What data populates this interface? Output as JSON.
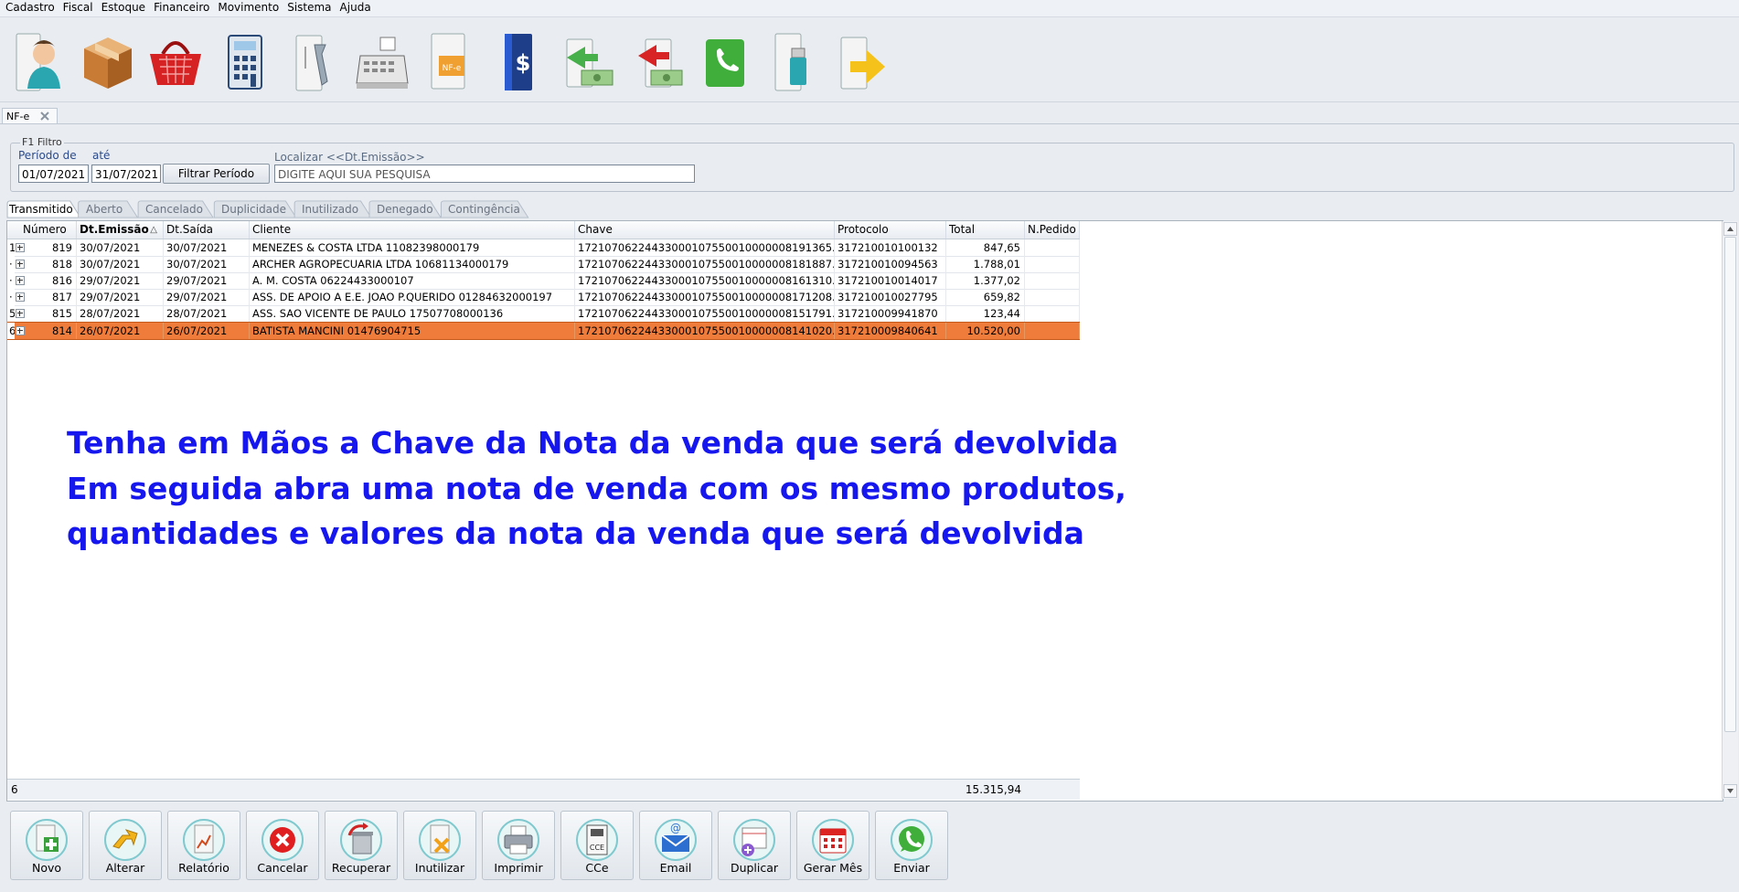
{
  "menu": [
    "Cadastro",
    "Fiscal",
    "Estoque",
    "Financeiro",
    "Movimento",
    "Sistema",
    "Ajuda"
  ],
  "toolbar_icons": [
    "client-icon",
    "product-box-icon",
    "shopping-basket-icon",
    "calculator-icon",
    "service-tools-icon",
    "cash-register-icon",
    "nfe-document-icon",
    "finance-book-icon",
    "receivable-money-icon",
    "payable-money-icon",
    "whatsapp-phone-icon",
    "usb-backup-icon",
    "exit-arrow-icon"
  ],
  "doc_tab": {
    "label": "NF-e"
  },
  "filter": {
    "legend": "F1 Filtro",
    "period_from_label": "Período de",
    "period_to_label": "até",
    "date_from": "01/07/2021",
    "date_to": "31/07/2021",
    "filter_button": "Filtrar Período",
    "search_label": "Localizar <<Dt.Emissão>>",
    "search_value": "DIGITE AQUI SUA PESQUISA"
  },
  "status_tabs": [
    "Transmitido",
    "Aberto",
    "Cancelado",
    "Duplicidade",
    "Inutilizado",
    "Denegado",
    "Contingência"
  ],
  "grid": {
    "headers": [
      "Número",
      "Dt.Emissão",
      "Dt.Saída",
      "Cliente",
      "Chave",
      "Protocolo",
      "Total",
      "N.Pedido"
    ],
    "rows": [
      {
        "ind": "1",
        "numero": "819",
        "emissao": "30/07/2021",
        "saida": "30/07/2021",
        "cliente": "MENEZES & COSTA LTDA  11082398000179",
        "chave": "17210706224433000107550010000008191365...",
        "protocolo": "317210010100132",
        "total": "847,65",
        "pedido": ""
      },
      {
        "ind": "·",
        "numero": "818",
        "emissao": "30/07/2021",
        "saida": "30/07/2021",
        "cliente": "ARCHER AGROPECUARIA LTDA 10681134000179",
        "chave": "17210706224433000107550010000008181887...",
        "protocolo": "317210010094563",
        "total": "1.788,01",
        "pedido": ""
      },
      {
        "ind": "·",
        "numero": "816",
        "emissao": "29/07/2021",
        "saida": "29/07/2021",
        "cliente": "A. M. COSTA 06224433000107",
        "chave": "17210706224433000107550010000008161310...",
        "protocolo": "317210010014017",
        "total": "1.377,02",
        "pedido": ""
      },
      {
        "ind": "·",
        "numero": "817",
        "emissao": "29/07/2021",
        "saida": "29/07/2021",
        "cliente": "ASS. DE APOIO A E.E. JOAO P.QUERIDO 01284632000197",
        "chave": "17210706224433000107550010000008171208...",
        "protocolo": "317210010027795",
        "total": "659,82",
        "pedido": ""
      },
      {
        "ind": "5",
        "numero": "815",
        "emissao": "28/07/2021",
        "saida": "28/07/2021",
        "cliente": "ASS. SAO VICENTE DE PAULO 17507708000136",
        "chave": "17210706224433000107550010000008151791...",
        "protocolo": "317210009941870",
        "total": "123,44",
        "pedido": ""
      },
      {
        "ind": "6",
        "numero": "814",
        "emissao": "26/07/2021",
        "saida": "26/07/2021",
        "cliente": "BATISTA MANCINI 01476904715",
        "chave": "17210706224433000107550010000008141020...",
        "protocolo": "317210009840641",
        "total": "10.520,00",
        "pedido": ""
      }
    ],
    "footer_count": "6",
    "footer_total": "15.315,94"
  },
  "overlay": {
    "line1": "Tenha em Mãos a Chave da Nota da venda que será devolvida",
    "line2": "Em seguida abra uma nota de venda com os mesmo produtos,",
    "line3": "quantidades e valores da nota da venda que será devolvida",
    "color": "#1616ee"
  },
  "buttons": [
    "Novo",
    "Alterar",
    "Relatório",
    "Cancelar",
    "Recuperar",
    "Inutilizar",
    "Imprimir",
    "CCe",
    "Email",
    "Duplicar",
    "Gerar Mês",
    "Enviar"
  ],
  "colors": {
    "selected_row": "#f07c3c",
    "background": "#e9edf2"
  }
}
